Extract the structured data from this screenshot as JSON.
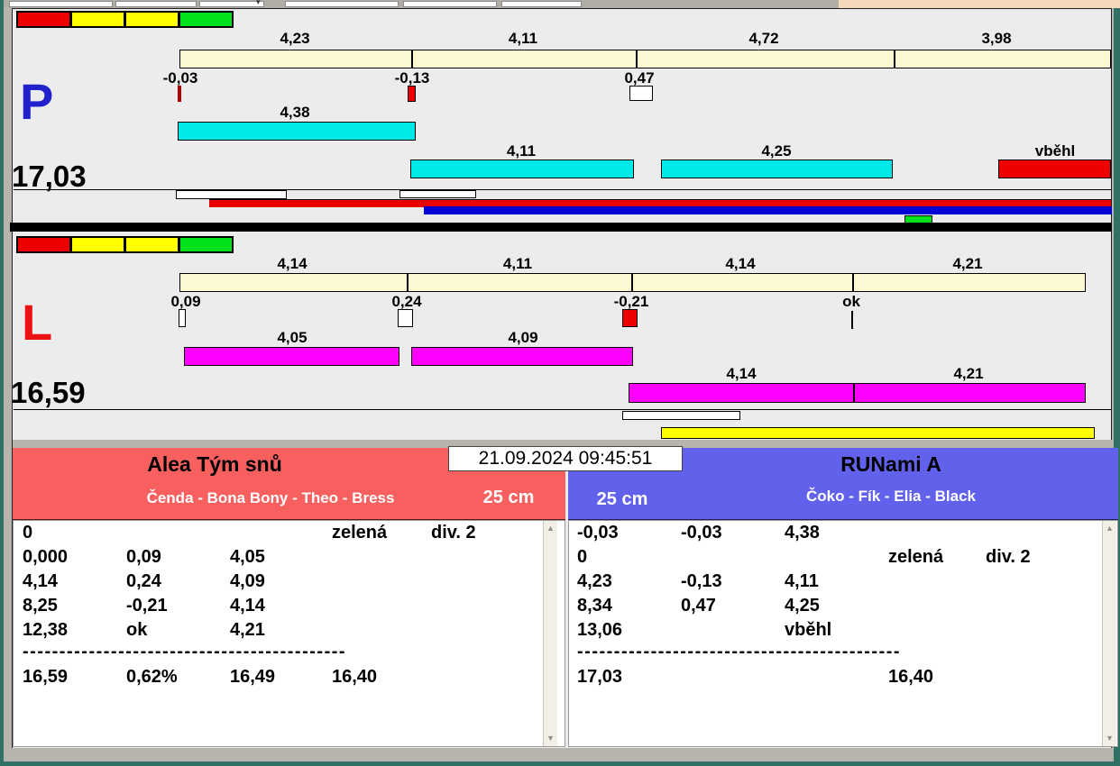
{
  "window": {
    "timestamp": "21.09.2024 09:45:51"
  },
  "icons": {
    "dropdown_caret": "▾",
    "scroll_up": "▲",
    "scroll_down": "▼"
  },
  "p_section": {
    "letter": "P",
    "total": "17,03",
    "scale_labels": [
      "4,23",
      "4,11",
      "4,72",
      "3,98"
    ],
    "marker_labels": [
      "-0,03",
      "-0,13",
      "0,47"
    ],
    "run1_label": "4,38",
    "run2_labels": [
      "4,11",
      "4,25"
    ],
    "run2_status": "vběhl"
  },
  "l_section": {
    "letter": "L",
    "total": "16,59",
    "scale_labels": [
      "4,14",
      "4,11",
      "4,14",
      "4,21"
    ],
    "marker_labels": [
      "0,09",
      "0,24",
      "-0,21",
      "ok"
    ],
    "run1_labels": [
      "4,05",
      "4,09"
    ],
    "run2_labels": [
      "4,14",
      "4,21"
    ]
  },
  "left_panel": {
    "team_name": "Alea Tým snů",
    "members": "Čenda - Bona Bony - Theo - Bress",
    "jump_height": "25 cm",
    "rows": [
      [
        "0",
        "",
        "",
        "zelená",
        "div. 2"
      ],
      [
        "0,000",
        "0,09",
        "4,05",
        "",
        ""
      ],
      [
        "4,14",
        "0,24",
        "4,09",
        "",
        ""
      ],
      [
        "8,25",
        "-0,21",
        "4,14",
        "",
        ""
      ],
      [
        "12,38",
        "ok",
        "4,21",
        "",
        ""
      ]
    ],
    "separator": "--------------------------------------------",
    "total_row": [
      "16,59",
      "0,62%",
      "16,49",
      "16,40",
      ""
    ]
  },
  "right_panel": {
    "team_name": "RUNami A",
    "members": "Čoko - Fík - Elia - Black",
    "jump_height": "25 cm",
    "rows": [
      [
        "-0,03",
        "-0,03",
        "4,38",
        "",
        ""
      ],
      [
        "0",
        "",
        "",
        "zelená",
        "div. 2"
      ],
      [
        "4,23",
        "-0,13",
        "4,11",
        "",
        ""
      ],
      [
        "8,34",
        "0,47",
        "4,25",
        "",
        ""
      ],
      [
        "13,06",
        "",
        "vběhl",
        "",
        ""
      ]
    ],
    "separator": "--------------------------------------------",
    "total_row": [
      "17,03",
      "",
      "",
      "16,40",
      ""
    ]
  },
  "colors": {
    "cream_scale": "#fbf8d2",
    "cyan_run": "#00e8e8",
    "magenta_run": "#ff00ff",
    "red": "#ee0000",
    "yellow": "#ffff00",
    "green": "#00e11c",
    "blue_overlay": "#0000d6",
    "p_letter_blue": "#2222cc",
    "l_letter_red": "#ee1111",
    "team_red_header": "#f7605f",
    "team_blue_header": "#6261eb",
    "window_teal": "#2f7265",
    "peach": "#f3d8ba"
  }
}
